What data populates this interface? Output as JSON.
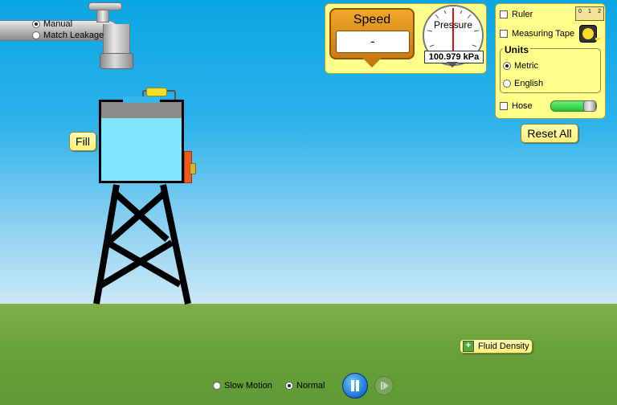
{
  "faucet": {
    "modes": [
      {
        "label": "Manual",
        "selected": true
      },
      {
        "label": "Match Leakage",
        "selected": false
      }
    ]
  },
  "tank": {
    "fill_label": "Fill",
    "water_fraction": 0.8
  },
  "speed": {
    "title": "Speed",
    "value": "-"
  },
  "pressure": {
    "title": "Pressure",
    "value": "100.979 kPa"
  },
  "tools": {
    "ruler": {
      "label": "Ruler",
      "checked": false
    },
    "measuring_tape": {
      "label": "Measuring Tape",
      "checked": false
    },
    "ruler_ticks": [
      "0",
      "1",
      "2"
    ],
    "units": {
      "title": "Units",
      "options": [
        {
          "label": "Metric",
          "selected": true
        },
        {
          "label": "English",
          "selected": false
        }
      ]
    },
    "hose": {
      "label": "Hose",
      "checked": false
    },
    "reset_label": "Reset All"
  },
  "fluid_density": {
    "label": "Fluid Density",
    "icon": "plus-icon"
  },
  "playback": {
    "speeds": [
      {
        "label": "Slow Motion",
        "selected": false
      },
      {
        "label": "Normal",
        "selected": true
      }
    ],
    "pause_icon": "pause-icon",
    "step_icon": "step-icon"
  },
  "colors": {
    "water": "#7fe5ff",
    "spigot": "#ef5a1c",
    "panel": "#fffe8a",
    "hose_slider": "#2ddc3a"
  }
}
